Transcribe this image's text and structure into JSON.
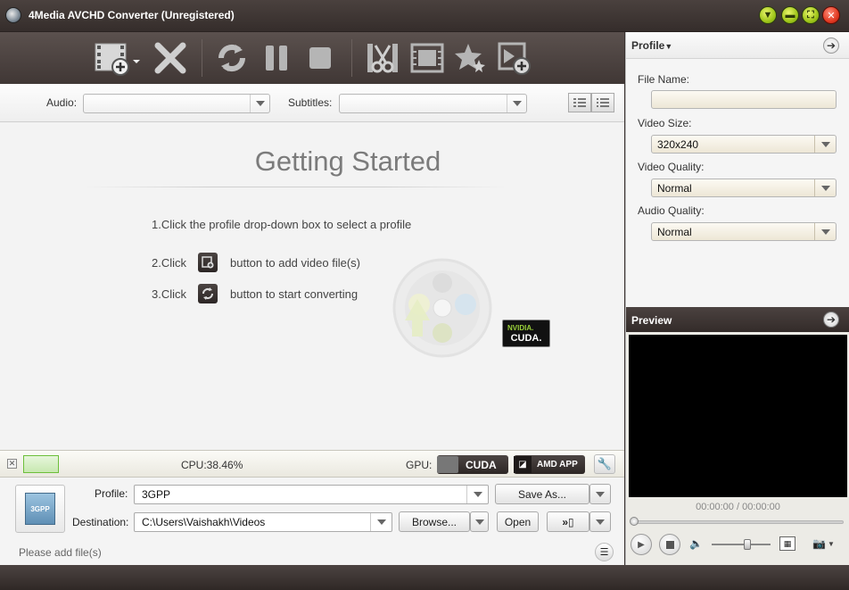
{
  "window": {
    "title": "4Media AVCHD Converter (Unregistered)",
    "controls": [
      "menu-dropdown",
      "minimize",
      "maximize",
      "close"
    ]
  },
  "toolbar": {
    "buttons": [
      {
        "name": "add-video",
        "icon": "film-add-icon"
      },
      {
        "name": "remove",
        "icon": "x-icon"
      },
      {
        "name": "convert",
        "icon": "refresh-icon"
      },
      {
        "name": "pause",
        "icon": "pause-icon"
      },
      {
        "name": "stop",
        "icon": "stop-icon"
      },
      {
        "name": "clip",
        "icon": "scissors-icon"
      },
      {
        "name": "merge",
        "icon": "film-strip-icon"
      },
      {
        "name": "effects",
        "icon": "star-icon"
      },
      {
        "name": "add-output",
        "icon": "film-plus-icon"
      }
    ]
  },
  "selbar": {
    "audio_label": "Audio:",
    "audio_value": "",
    "subtitles_label": "Subtitles:",
    "subtitles_value": ""
  },
  "main": {
    "title": "Getting Started",
    "step1": "1.Click the profile drop-down box to select a profile",
    "step2_prefix": "2.Click",
    "step2_suffix": "button to add video file(s)",
    "step3_prefix": "3.Click",
    "step3_suffix": "button to start converting",
    "cuda_badge_top": "NVIDIA.",
    "cuda_badge_bottom": "CUDA."
  },
  "statusbar": {
    "cpu": "CPU:38.46%",
    "gpu_label": "GPU:",
    "cuda_label": "CUDA",
    "amd_label": "AMD APP"
  },
  "bottom": {
    "profile_label": "Profile:",
    "profile_value": "3GPP",
    "save_as_label": "Save As...",
    "destination_label": "Destination:",
    "destination_value": "C:\\Users\\Vaishakh\\Videos",
    "browse_label": "Browse...",
    "open_label": "Open",
    "status_text": "Please add file(s)",
    "profile_thumb": "3GPP"
  },
  "profile_panel": {
    "header": "Profile",
    "file_name_label": "File Name:",
    "file_name_value": "",
    "video_size_label": "Video Size:",
    "video_size_value": "320x240",
    "video_quality_label": "Video Quality:",
    "video_quality_value": "Normal",
    "audio_quality_label": "Audio Quality:",
    "audio_quality_value": "Normal"
  },
  "preview_panel": {
    "header": "Preview",
    "time": "00:00:00 / 00:00:00",
    "progress": 0,
    "volume": 0.6
  }
}
